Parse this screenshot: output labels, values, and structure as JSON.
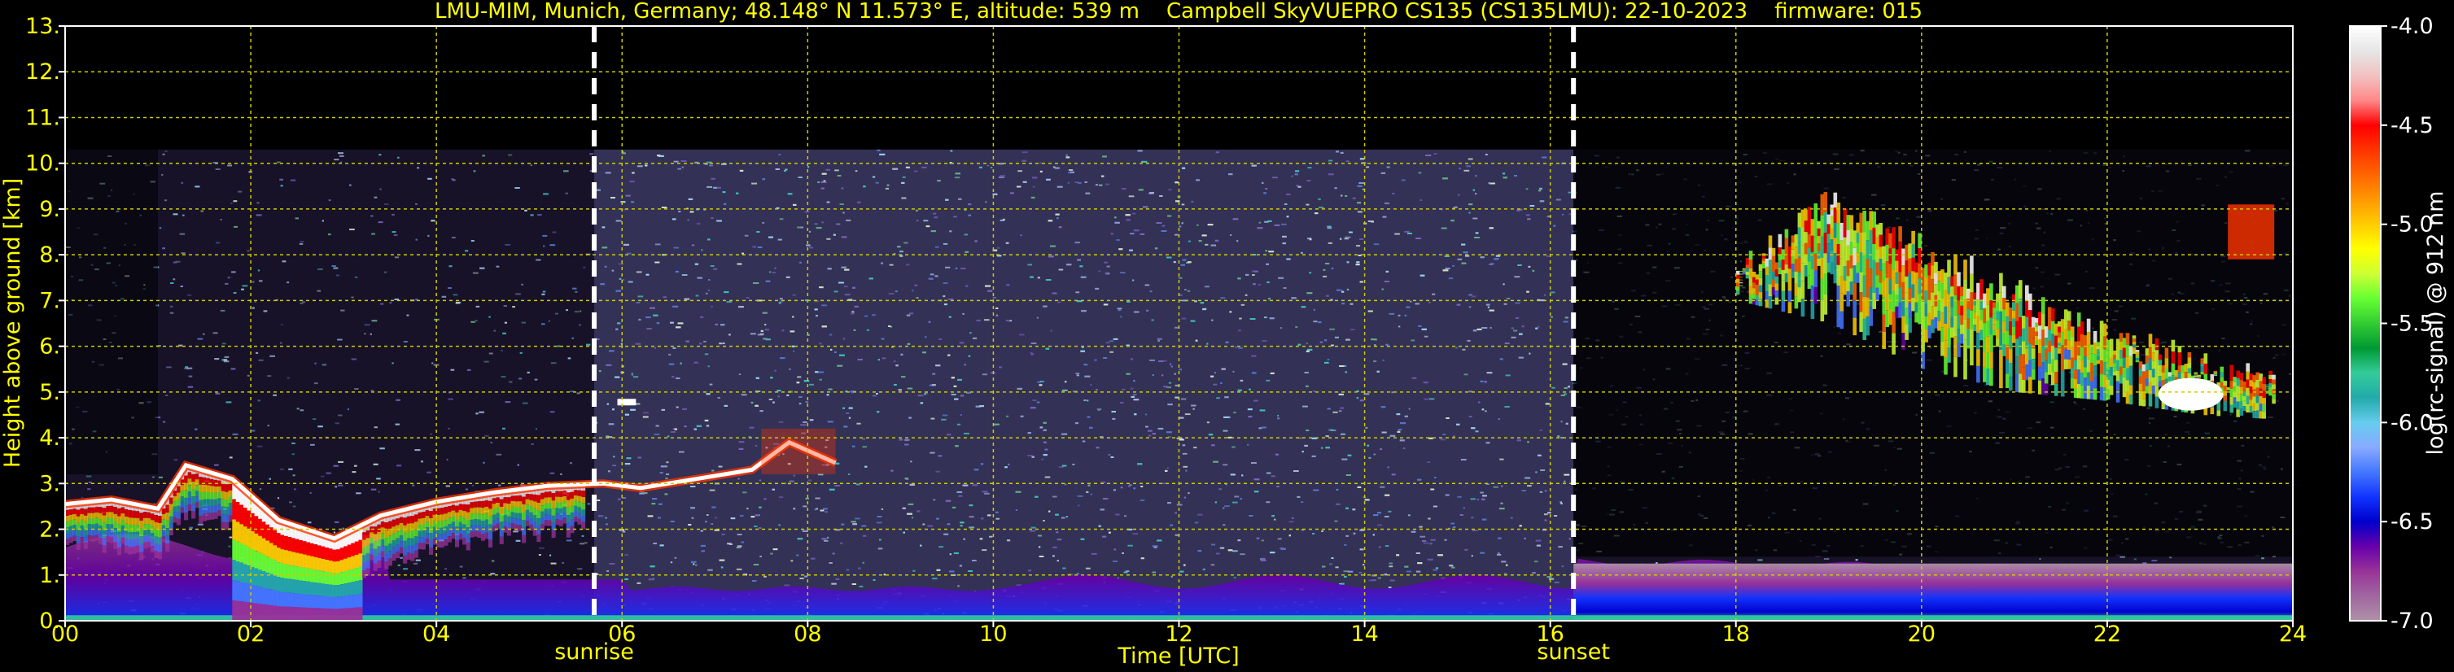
{
  "chart_data": {
    "type": "heatmap",
    "title": "LMU-MIM, Munich, Germany; 48.148° N 11.573° E, altitude: 539 m    Campbell SkyVUEPRO CS135 (CS135LMU): 22-10-2023    firmware: 015",
    "xlabel": "Time [UTC]",
    "ylabel": "Height above ground [km]",
    "xlim": [
      0,
      24
    ],
    "ylim": [
      0,
      13
    ],
    "x_ticks": [
      "00",
      "02",
      "04",
      "06",
      "08",
      "10",
      "12",
      "14",
      "16",
      "18",
      "20",
      "22",
      "24"
    ],
    "y_ticks": [
      "0.",
      "1.",
      "2.",
      "3.",
      "4.",
      "5.",
      "6.",
      "7.",
      "8.",
      "9.",
      "10.",
      "11.",
      "12.",
      "13."
    ],
    "grid": true,
    "vertical_markers": [
      {
        "label": "sunrise",
        "x": 5.7
      },
      {
        "label": "sunset",
        "x": 16.25
      }
    ],
    "colorbar": {
      "label": "log(rc-signal) @ 912 nm",
      "range": [
        -7.0,
        -4.0
      ],
      "ticks": [
        "-4.0",
        "-4.5",
        "-5.0",
        "-5.5",
        "-6.0",
        "-6.5",
        "-7.0"
      ],
      "colors": [
        "#ffffff",
        "#e6e6e6",
        "#f2c2c2",
        "#ff8888",
        "#ff0000",
        "#ff3300",
        "#ff6600",
        "#ff9900",
        "#ffcc00",
        "#ffff00",
        "#ccff33",
        "#66ff33",
        "#33cc33",
        "#009933",
        "#33cc99",
        "#22aaaa",
        "#66ccee",
        "#88aaff",
        "#4477ff",
        "#1133ff",
        "#0000cc",
        "#6600aa",
        "#993399",
        "#a066a0",
        "#b090a8"
      ]
    },
    "features": {
      "noise_top_km": 10.3,
      "boundary_layer_top": [
        {
          "x": 0.0,
          "y": 2.55
        },
        {
          "x": 0.5,
          "y": 2.65
        },
        {
          "x": 1.0,
          "y": 2.45
        },
        {
          "x": 1.3,
          "y": 3.4
        },
        {
          "x": 1.8,
          "y": 3.1
        },
        {
          "x": 2.3,
          "y": 2.2
        },
        {
          "x": 2.9,
          "y": 1.8
        },
        {
          "x": 3.4,
          "y": 2.3
        },
        {
          "x": 4.0,
          "y": 2.6
        },
        {
          "x": 4.6,
          "y": 2.8
        },
        {
          "x": 5.2,
          "y": 2.95
        },
        {
          "x": 5.8,
          "y": 3.0
        },
        {
          "x": 6.2,
          "y": 2.9
        },
        {
          "x": 6.8,
          "y": 3.1
        },
        {
          "x": 7.4,
          "y": 3.3
        },
        {
          "x": 7.8,
          "y": 3.9
        },
        {
          "x": 8.3,
          "y": 3.45
        }
      ],
      "cirrus_band": [
        {
          "x": 18.0,
          "y_top": 8.0,
          "y_bot": 7.0
        },
        {
          "x": 19.0,
          "y_top": 9.5,
          "y_bot": 6.5
        },
        {
          "x": 20.0,
          "y_top": 8.5,
          "y_bot": 5.5
        },
        {
          "x": 21.0,
          "y_top": 7.5,
          "y_bot": 5.0
        },
        {
          "x": 22.0,
          "y_top": 6.5,
          "y_bot": 4.8
        },
        {
          "x": 23.0,
          "y_top": 6.0,
          "y_bot": 4.5
        },
        {
          "x": 23.8,
          "y_top": 5.5,
          "y_bot": 4.4
        }
      ]
    }
  }
}
